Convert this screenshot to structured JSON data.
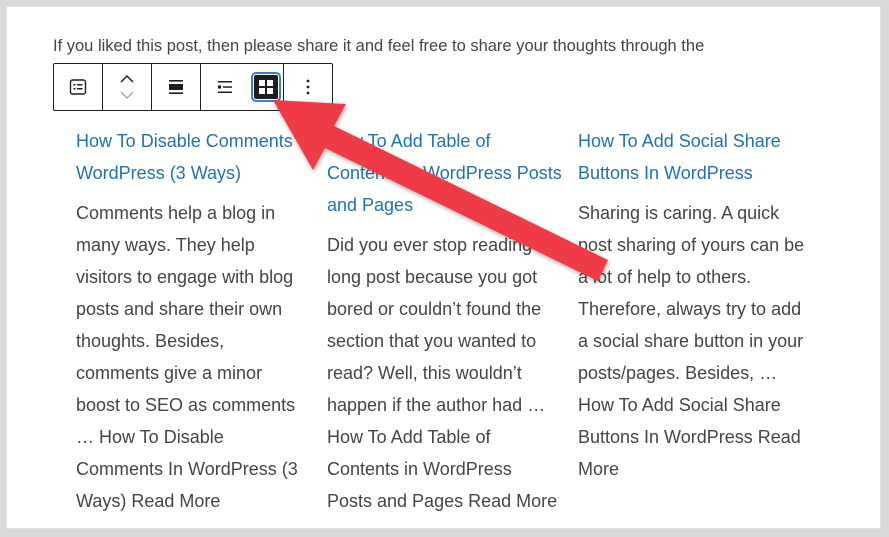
{
  "intro_text": "If you liked this post, then please share it and feel free to share your thoughts through the",
  "toolbar": {
    "buttons": [
      "list-view-icon",
      "move-up-down-icon",
      "align-icon",
      "list-layout-icon",
      "grid-layout-icon",
      "more-options-icon"
    ],
    "active": "grid-layout-icon"
  },
  "posts": [
    {
      "title": "How To Disable Comments In WordPress (3 Ways)",
      "excerpt": "Comments help a blog in many ways. They help visitors to engage with blog posts and share their own thoughts. Besides, comments give a minor boost to SEO as comments … How To Disable Comments In WordPress (3 Ways) Read More"
    },
    {
      "title": "How To Add Table of Contents in WordPress Posts and Pages",
      "excerpt": "Did you ever stop reading long post because you got bored or couldn’t found the section that you wanted to read? Well, this wouldn’t happen if the author had … How To Add Table of Contents in WordPress Posts and Pages Read More"
    },
    {
      "title": "How To Add Social Share Buttons In WordPress",
      "excerpt": "Sharing is caring. A quick post sharing of yours can be a lot of help to others. Therefore, always try to add a social share button in your posts/pages. Besides, … How To Add Social Share Buttons In WordPress Read More"
    }
  ],
  "colors": {
    "link": "#2271b1",
    "text": "#454545",
    "arrow": "#ee3b45",
    "focus": "#3582c4"
  }
}
